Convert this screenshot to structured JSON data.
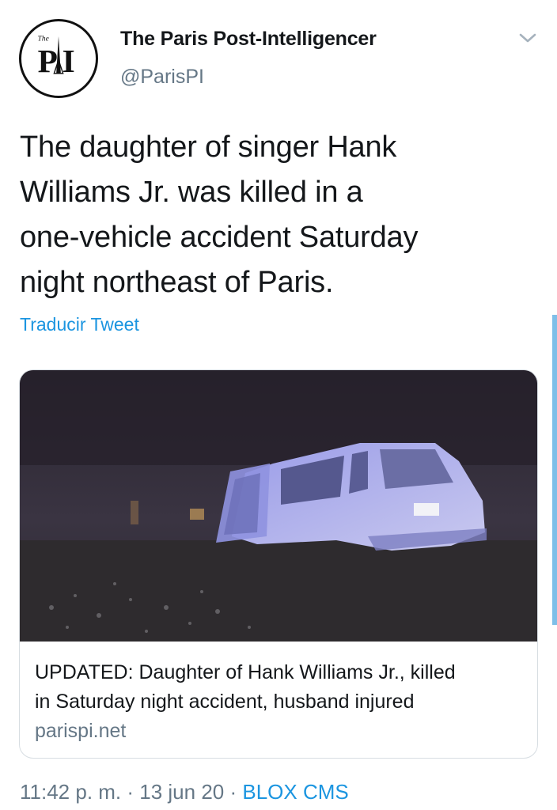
{
  "account": {
    "name": "The Paris Post-Intelligencer",
    "handle": "@ParisPI",
    "avatar_text": "PI",
    "avatar_small_text": "The"
  },
  "tweet": {
    "lines": [
      "The daughter of singer Hank",
      "Williams Jr. was killed in a",
      "one-vehicle accident Saturday",
      "night northeast of Paris."
    ],
    "translate_label": "Traducir Tweet"
  },
  "card": {
    "title_lines": [
      "UPDATED: Daughter of Hank Williams Jr., killed",
      "in Saturday night accident, husband injured"
    ],
    "domain": "parispi.net",
    "image_icon": "crashed-suv-photo"
  },
  "meta": {
    "time": "11:42 p. m.",
    "separator": " · ",
    "date": "13 jun 20",
    "source": "BLOX CMS"
  },
  "icons": {
    "menu": "chevron-down-icon"
  },
  "colors": {
    "text": "#14171a",
    "secondary": "#657786",
    "link": "#1b95e0",
    "border": "#d7dde2"
  }
}
